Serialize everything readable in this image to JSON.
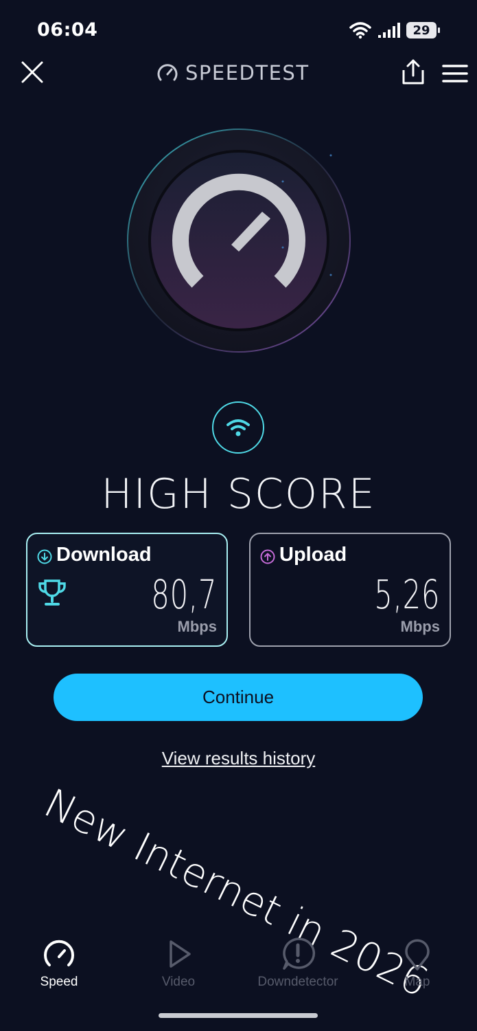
{
  "status_bar": {
    "time": "06:04",
    "battery": "29",
    "icons": [
      "wifi-icon",
      "signal-icon",
      "battery-icon"
    ]
  },
  "header": {
    "title": "SPEEDTEST",
    "icons": [
      "close-icon",
      "speedometer-icon",
      "share-icon",
      "menu-icon"
    ]
  },
  "result": {
    "label": "HIGH SCORE"
  },
  "download": {
    "title": "Download",
    "value": "80,7",
    "unit": "Mbps"
  },
  "upload": {
    "title": "Upload",
    "value": "5,26",
    "unit": "Mbps"
  },
  "actions": {
    "continue_label": "Continue",
    "history_label": "View results history"
  },
  "overlay_text": "New Internet in 2026",
  "nav": [
    {
      "label": "Speed",
      "icon": "speedometer-icon",
      "active": true
    },
    {
      "label": "Video",
      "icon": "play-icon",
      "active": false
    },
    {
      "label": "Downdetector",
      "icon": "alert-icon",
      "active": false
    },
    {
      "label": "Map",
      "icon": "map-pin-icon",
      "active": false
    }
  ],
  "colors": {
    "background": "#0c1021",
    "accent": "#1ec0ff",
    "download_border": "#a9f0f3",
    "upload_icon": "#c46bd6"
  }
}
